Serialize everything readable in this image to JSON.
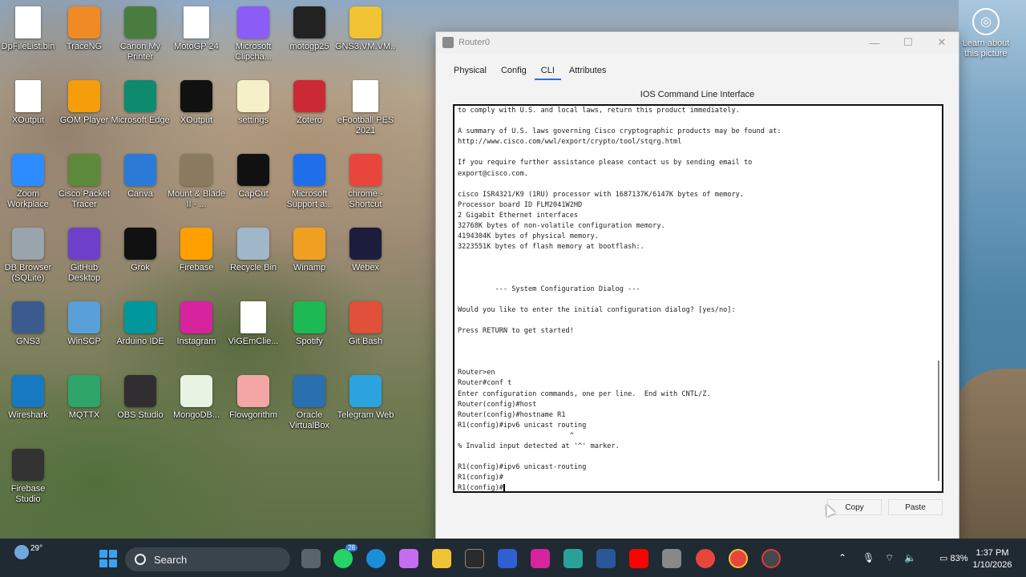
{
  "desktop": {
    "icons": [
      {
        "label": "DpFileList.bin",
        "icon": "file-icon",
        "color": "#ffffff"
      },
      {
        "label": "TraceNG",
        "icon": "traceng-icon",
        "color": "#f08a24"
      },
      {
        "label": "Canon My Printer",
        "icon": "printer-icon",
        "color": "#4a7c3f"
      },
      {
        "label": "MotoGP 24",
        "icon": "file-icon",
        "color": "#ffffff"
      },
      {
        "label": "Microsoft Clipcha...",
        "icon": "clipchamp-icon",
        "color": "#8b5cf6"
      },
      {
        "label": "motogp25",
        "icon": "epic-games-icon",
        "color": "#222222"
      },
      {
        "label": "GNS3.VM.VM...",
        "icon": "folder-icon",
        "color": "#f1c232"
      },
      {
        "label": "XOutput",
        "icon": "file-icon",
        "color": "#ffffff"
      },
      {
        "label": "GOM Player",
        "icon": "gom-player-icon",
        "color": "#f59e0b"
      },
      {
        "label": "Microsoft Edge",
        "icon": "edge-icon",
        "color": "#0e8a6f"
      },
      {
        "label": "XOutput",
        "icon": "x-icon",
        "color": "#111111"
      },
      {
        "label": "settings",
        "icon": "json-icon",
        "color": "#f5f0c8"
      },
      {
        "label": "Zotero",
        "icon": "zotero-icon",
        "color": "#cc2936"
      },
      {
        "label": "eFootball PES 2021",
        "icon": "file-icon",
        "color": "#ffffff"
      },
      {
        "label": "Zoom Workplace",
        "icon": "zoom-icon",
        "color": "#2d8cff"
      },
      {
        "label": "Cisco Packet Tracer",
        "icon": "packet-tracer-icon",
        "color": "#5d8a3a"
      },
      {
        "label": "Canva",
        "icon": "canva-icon",
        "color": "#2b7bd6"
      },
      {
        "label": "Mount & Blade II - ...",
        "icon": "mount-blade-icon",
        "color": "#8a7a60"
      },
      {
        "label": "CapCut",
        "icon": "capcut-icon",
        "color": "#111111"
      },
      {
        "label": "Microsoft Support a...",
        "icon": "support-icon",
        "color": "#1f6feb"
      },
      {
        "label": "chrome - Shortcut",
        "icon": "chrome-icon",
        "color": "#e8453c"
      },
      {
        "label": "DB Browser (SQLite)",
        "icon": "database-icon",
        "color": "#9aa4ad"
      },
      {
        "label": "GitHub Desktop",
        "icon": "github-icon",
        "color": "#6e40c9"
      },
      {
        "label": "Grok",
        "icon": "grok-icon",
        "color": "#111111"
      },
      {
        "label": "Firebase",
        "icon": "firebase-icon",
        "color": "#ffa000"
      },
      {
        "label": "Recycle Bin",
        "icon": "recycle-bin-icon",
        "color": "#9fb7c9"
      },
      {
        "label": "Winamp",
        "icon": "winamp-icon",
        "color": "#f0a020"
      },
      {
        "label": "Webex",
        "icon": "webex-icon",
        "color": "#1c1c3c"
      },
      {
        "label": "GNS3",
        "icon": "gns3-icon",
        "color": "#3b5b8f"
      },
      {
        "label": "WinSCP",
        "icon": "winscp-icon",
        "color": "#5aa0d8"
      },
      {
        "label": "Arduino IDE",
        "icon": "arduino-icon",
        "color": "#00979d"
      },
      {
        "label": "Instagram",
        "icon": "instagram-icon",
        "color": "#d6249f"
      },
      {
        "label": "ViGEmClie...",
        "icon": "file-icon",
        "color": "#ffffff"
      },
      {
        "label": "Spotify",
        "icon": "spotify-icon",
        "color": "#1db954"
      },
      {
        "label": "Git Bash",
        "icon": "git-bash-icon",
        "color": "#e0503a"
      },
      {
        "label": "Wireshark",
        "icon": "wireshark-icon",
        "color": "#1679c2"
      },
      {
        "label": "MQTTX",
        "icon": "mqttx-icon",
        "color": "#2fa56a"
      },
      {
        "label": "OBS Studio",
        "icon": "obs-icon",
        "color": "#302e31"
      },
      {
        "label": "MongoDB...",
        "icon": "mongodb-icon",
        "color": "#e8f3e3"
      },
      {
        "label": "Flowgorithm",
        "icon": "flowgorithm-icon",
        "color": "#f4a6a6"
      },
      {
        "label": "Oracle VirtualBox",
        "icon": "virtualbox-icon",
        "color": "#2a6fb0"
      },
      {
        "label": "Telegram Web",
        "icon": "telegram-icon",
        "color": "#2aa3df"
      },
      {
        "label": "Firebase Studio",
        "icon": "firebase-studio-icon",
        "color": "#333333"
      }
    ],
    "learn_label": "Learn about this picture"
  },
  "window": {
    "title": "Router0",
    "tabs": [
      "Physical",
      "Config",
      "CLI",
      "Attributes"
    ],
    "active_tab": "CLI",
    "cli_title": "IOS Command Line Interface",
    "terminal_lines": [
      "to comply with U.S. and local laws, return this product immediately.",
      "",
      "A summary of U.S. laws governing Cisco cryptographic products may be found at:",
      "http://www.cisco.com/wwl/export/crypto/tool/stqrg.html",
      "",
      "If you require further assistance please contact us by sending email to",
      "export@cisco.com.",
      "",
      "cisco ISR4321/K9 (1RU) processor with 1687137K/6147K bytes of memory.",
      "Processor board ID FLM2041W2HD",
      "2 Gigabit Ethernet interfaces",
      "32768K bytes of non-volatile configuration memory.",
      "4194304K bytes of physical memory.",
      "3223551K bytes of flash memory at bootflash:.",
      "",
      "",
      "",
      "         --- System Configuration Dialog ---",
      "",
      "Would you like to enter the initial configuration dialog? [yes/no]:",
      "",
      "Press RETURN to get started!",
      "",
      "",
      "",
      "Router>en",
      "Router#conf t",
      "Enter configuration commands, one per line.  End with CNTL/Z.",
      "Router(config)#host",
      "Router(config)#hostname R1",
      "R1(config)#ipv6 unicast routing",
      "                           ^",
      "% Invalid input detected at '^' marker.",
      "",
      "R1(config)#ipv6 unicast-routing",
      "R1(config)#",
      "R1(config)#"
    ],
    "copy_label": "Copy",
    "paste_label": "Paste"
  },
  "taskbar": {
    "temperature": "29°",
    "search_placeholder": "Search",
    "whatsapp_badge": "28",
    "battery": "83%",
    "time": "1:37 PM",
    "date": "1/10/2026"
  }
}
